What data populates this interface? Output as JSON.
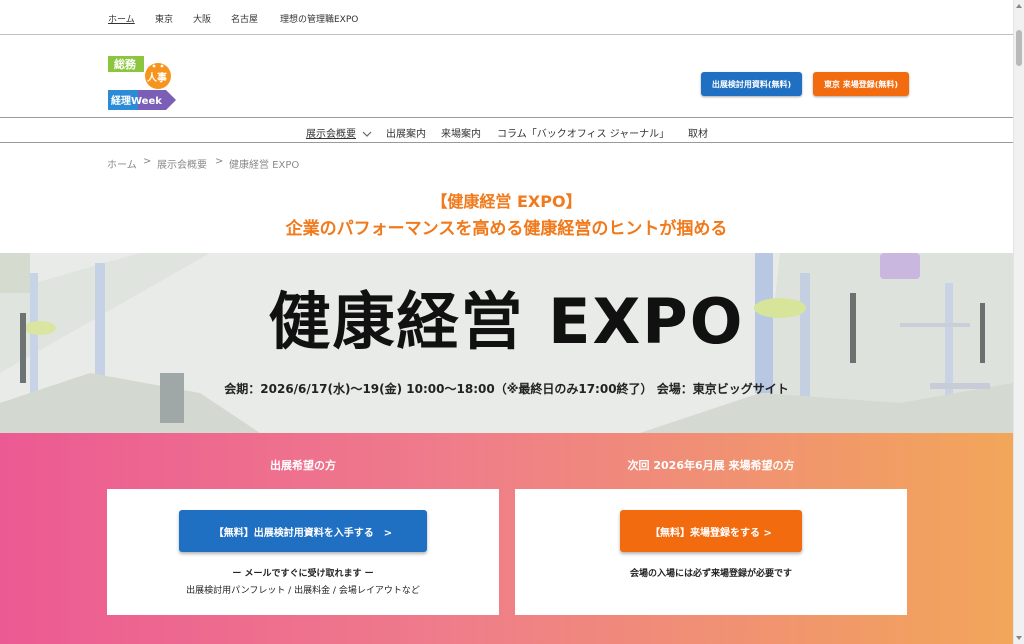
{
  "topnav": {
    "items": [
      "ホーム",
      "東京",
      "大阪",
      "名古屋",
      "理想の管理職EXPO"
    ]
  },
  "logo": {
    "line1": "総務",
    "line2": "人事",
    "line3": "経理Week"
  },
  "header": {
    "btn_docs": "出展検討用資料(無料)",
    "btn_register": "東京 来場登録(無料)"
  },
  "mainnav": {
    "items": [
      "展示会概要",
      "出展案内",
      "来場案内",
      "コラム「バックオフィス ジャーナル」",
      "取材"
    ]
  },
  "breadcrumb": {
    "home": "ホーム",
    "sep": ">",
    "overview": "展示会概要",
    "current": "健康経営 EXPO"
  },
  "title": {
    "line1": "【健康経営 EXPO】",
    "line2": "企業のパフォーマンスを高める健康経営のヒントが掴める"
  },
  "hero": {
    "title": "健康経営 EXPO",
    "dates": "会期：2026/6/17(水)～19(金) 10:00～18:00（※最終日のみ17:00終了）  会場：東京ビッグサイト"
  },
  "cta": {
    "exhibitor_heading": "出展希望の方",
    "exhibitor_button": "【無料】出展検討用資料を入手する　>",
    "exhibitor_note1": "ー メールですぐに受け取れます ー",
    "exhibitor_note2": "出展検討用パンフレット / 出展料金 / 会場レイアウトなど",
    "visitor_heading": "次回 2026年6月展  来場希望の方",
    "visitor_button": "【無料】来場登録をする >",
    "visitor_note": "会場の入場には必ず来場登録が必要です"
  },
  "colors": {
    "accent_orange": "#f07a1c",
    "button_blue": "#1f6fc2",
    "button_orange": "#f26b0f"
  },
  "icons": [
    "chevron-down-icon",
    "scroll-up-arrow-icon",
    "scroll-down-arrow-icon"
  ]
}
